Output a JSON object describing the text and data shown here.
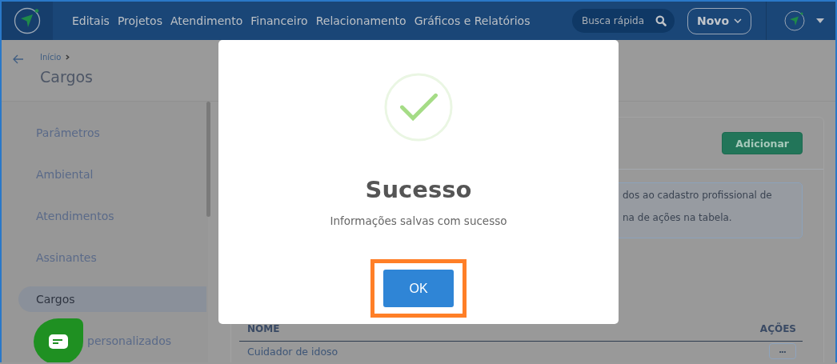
{
  "header": {
    "nav": [
      {
        "label": "Editais"
      },
      {
        "label": "Projetos"
      },
      {
        "label": "Atendimento"
      },
      {
        "label": "Financeiro"
      },
      {
        "label": "Relacionamento"
      },
      {
        "label": "Gráficos e Relatórios"
      }
    ],
    "search": {
      "placeholder": "Busca rápida"
    },
    "new_button": {
      "label": "Novo"
    }
  },
  "breadcrumb": {
    "items": [
      "Início"
    ]
  },
  "page_title": "Cargos",
  "sidebar": {
    "items": [
      {
        "label": "Parâmetros",
        "selected": false
      },
      {
        "label": "Ambiental",
        "selected": false
      },
      {
        "label": "Atendimentos",
        "selected": false
      },
      {
        "label": "Assinantes",
        "selected": false
      },
      {
        "label": "Cargos",
        "selected": true
      },
      {
        "label": "personalizados",
        "selected": false
      }
    ]
  },
  "card": {
    "add_button": "Adicionar",
    "info": [
      "dos ao cadastro profissional de",
      "na de ações na tabela."
    ],
    "table": {
      "columns": [
        "NOME",
        "AÇÕES"
      ],
      "rows": [
        {
          "name": "Cuidador de idoso",
          "actions": "•••"
        }
      ]
    }
  },
  "dialog": {
    "title": "Sucesso",
    "message": "Informações salvas com sucesso",
    "ok_button": {
      "label": "OK",
      "highlighted": true
    }
  }
}
